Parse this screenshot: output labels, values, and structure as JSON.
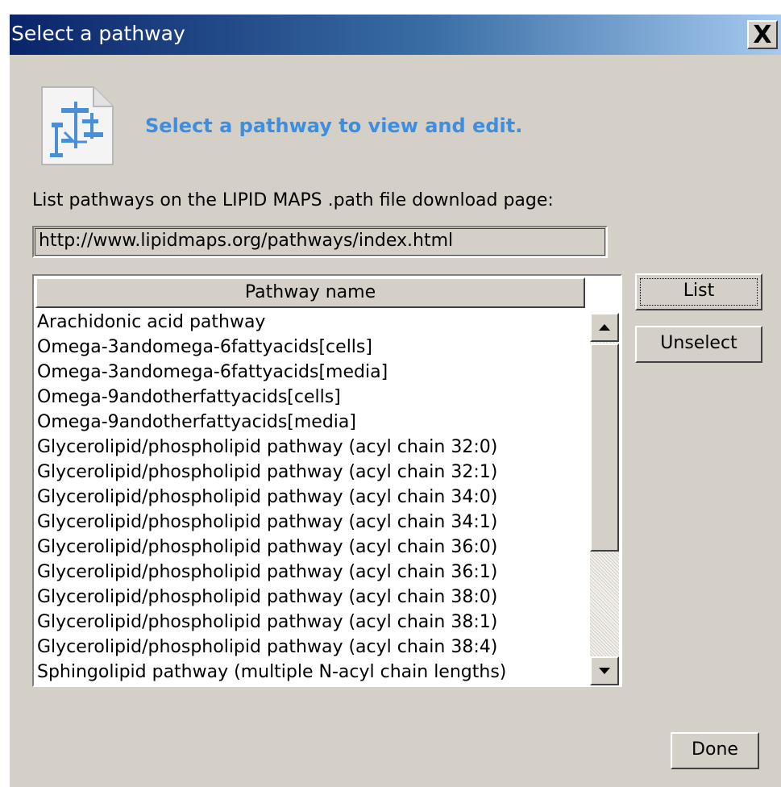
{
  "window": {
    "title": "Select a pathway",
    "close_label": "X"
  },
  "header": {
    "icon": "pathway-document-icon",
    "heading": "Select a pathway to view and edit."
  },
  "source": {
    "label": "List pathways on the LIPID MAPS .path file download page:",
    "url": "http://www.lipidmaps.org/pathways/index.html"
  },
  "table": {
    "column_header": "Pathway name",
    "rows": [
      "Arachidonic acid pathway",
      "Omega-3andomega-6fattyacids[cells]",
      "Omega-3andomega-6fattyacids[media]",
      "Omega-9andotherfattyacids[cells]",
      "Omega-9andotherfattyacids[media]",
      "Glycerolipid/phospholipid pathway (acyl chain 32:0)",
      "Glycerolipid/phospholipid pathway (acyl chain 32:1)",
      "Glycerolipid/phospholipid pathway (acyl chain 34:0)",
      "Glycerolipid/phospholipid pathway (acyl chain 34:1)",
      "Glycerolipid/phospholipid pathway (acyl chain 36:0)",
      "Glycerolipid/phospholipid pathway (acyl chain 36:1)",
      "Glycerolipid/phospholipid pathway (acyl chain 38:0)",
      "Glycerolipid/phospholipid pathway (acyl chain 38:1)",
      "Glycerolipid/phospholipid pathway (acyl chain 38:4)",
      "Sphingolipid pathway (multiple N-acyl chain lengths)"
    ]
  },
  "buttons": {
    "list": "List",
    "unselect": "Unselect",
    "done": "Done"
  },
  "colors": {
    "title_bar_start": "#0a246a",
    "title_bar_end": "#a6caf0",
    "heading": "#3d8ee0",
    "dialog_background": "#d4d0c8"
  }
}
